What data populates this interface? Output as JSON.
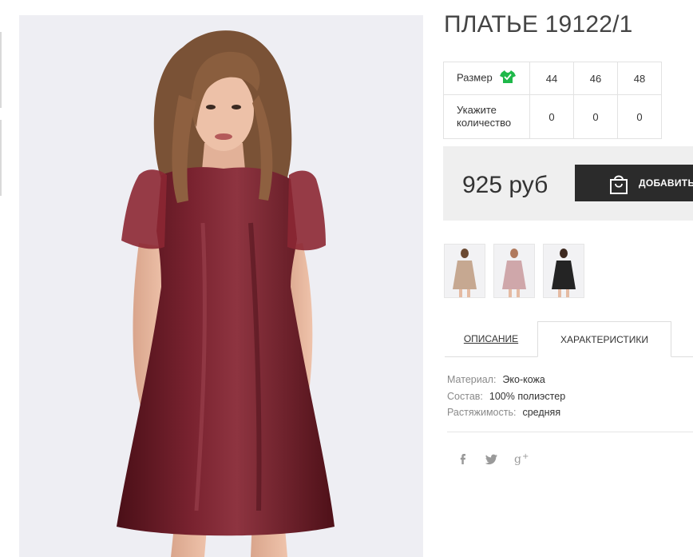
{
  "product": {
    "title": "ПЛАТЬЕ 19122/1",
    "price": "925 руб",
    "add_button_label": "ДОБАВИТЬ"
  },
  "size_table": {
    "size_label": "Размер",
    "quantity_label_line1": "Укажите",
    "quantity_label_line2": "количество",
    "sizes": [
      "44",
      "46",
      "48"
    ],
    "quantities": [
      "0",
      "0",
      "0"
    ],
    "size_icon": "tshirt-icon"
  },
  "tabs": {
    "description": "ОПИСАНИЕ",
    "characteristics": "ХАРАКТЕРИСТИКИ",
    "active": "characteristics"
  },
  "specs": [
    {
      "key": "Материал:",
      "value": "Эко-кожа"
    },
    {
      "key": "Состав:",
      "value": "100% полиэстер"
    },
    {
      "key": "Растяжимость:",
      "value": "средняя"
    }
  ],
  "thumbnails": [
    {
      "name": "beige-dress-thumbnail"
    },
    {
      "name": "pink-dress-thumbnail"
    },
    {
      "name": "black-dress-thumbnail"
    }
  ],
  "social": [
    "facebook-icon",
    "twitter-icon",
    "google-plus-icon"
  ],
  "colors": {
    "dress": "#6b1a24",
    "button_bg": "#2b2b2b",
    "buy_panel_bg": "#efefef",
    "size_icon": "#1fb84a"
  }
}
